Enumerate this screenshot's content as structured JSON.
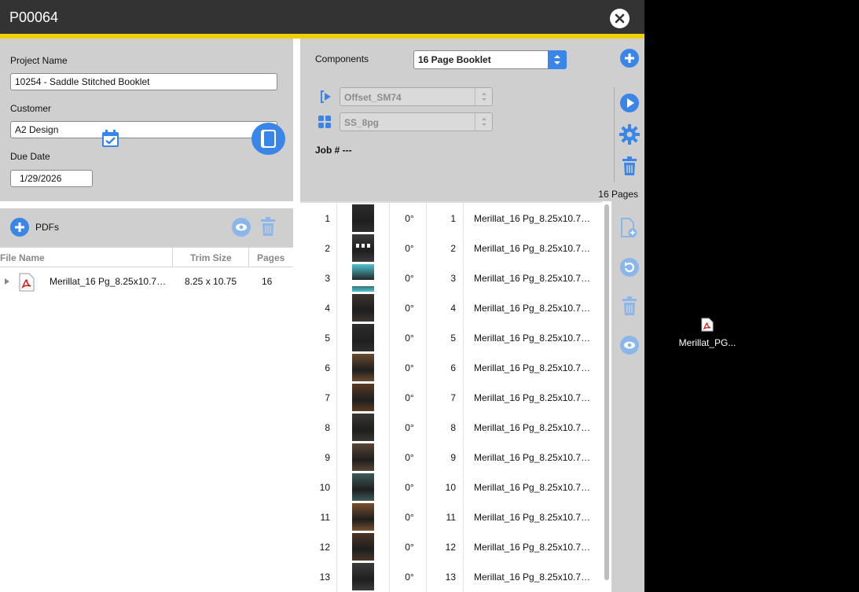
{
  "window": {
    "title": "P00064"
  },
  "project": {
    "project_name_label": "Project Name",
    "project_name_value": "10254 - Saddle Stitched Booklet",
    "customer_label": "Customer",
    "customer_value": "A2 Design",
    "due_date_label": "Due Date",
    "due_date_value": "1/29/2026"
  },
  "pdfs": {
    "label": "PDFs",
    "columns": [
      "File Name",
      "Trim Size",
      "Pages"
    ],
    "rows": [
      {
        "file_name": "Merillat_16 Pg_8.25x10.7…",
        "trim_size": "8.25 x 10.75",
        "pages": "16"
      }
    ]
  },
  "components": {
    "label": "Components",
    "selected": "16 Page Booklet",
    "press": "Offset_SM74",
    "imposition": "SS_8pg",
    "job_label": "Job # ---",
    "page_count": "16 Pages"
  },
  "pages": [
    {
      "n": "1",
      "rotation": "0°",
      "page": "1",
      "file": "Merillat_16 Pg_8.25x10.7…"
    },
    {
      "n": "2",
      "rotation": "0°",
      "page": "2",
      "file": "Merillat_16 Pg_8.25x10.7…"
    },
    {
      "n": "3",
      "rotation": "0°",
      "page": "3",
      "file": "Merillat_16 Pg_8.25x10.7…"
    },
    {
      "n": "4",
      "rotation": "0°",
      "page": "4",
      "file": "Merillat_16 Pg_8.25x10.7…"
    },
    {
      "n": "5",
      "rotation": "0°",
      "page": "5",
      "file": "Merillat_16 Pg_8.25x10.7…"
    },
    {
      "n": "6",
      "rotation": "0°",
      "page": "6",
      "file": "Merillat_16 Pg_8.25x10.7…"
    },
    {
      "n": "7",
      "rotation": "0°",
      "page": "7",
      "file": "Merillat_16 Pg_8.25x10.7…"
    },
    {
      "n": "8",
      "rotation": "0°",
      "page": "8",
      "file": "Merillat_16 Pg_8.25x10.7…"
    },
    {
      "n": "9",
      "rotation": "0°",
      "page": "9",
      "file": "Merillat_16 Pg_8.25x10.7…"
    },
    {
      "n": "10",
      "rotation": "0°",
      "page": "10",
      "file": "Merillat_16 Pg_8.25x10.7…"
    },
    {
      "n": "11",
      "rotation": "0°",
      "page": "11",
      "file": "Merillat_16 Pg_8.25x10.7…"
    },
    {
      "n": "12",
      "rotation": "0°",
      "page": "12",
      "file": "Merillat_16 Pg_8.25x10.7…"
    },
    {
      "n": "13",
      "rotation": "0°",
      "page": "13",
      "file": "Merillat_16 Pg_8.25x10.7…"
    }
  ],
  "desktop": {
    "icon_label": "Merillat_PG..."
  },
  "colors": {
    "accent": "#3a86e8",
    "title_bar": "#333333",
    "highlight_bar": "#f1cf0a",
    "panel": "#cfcfcf"
  },
  "icons": [
    "close-icon",
    "calendar-icon",
    "booklet-icon",
    "add-icon",
    "eye-icon",
    "trash-icon",
    "pdf-file-icon",
    "press-icon",
    "imposition-icon",
    "play-icon",
    "settings-icon",
    "add-page-icon",
    "rotate-icon"
  ]
}
